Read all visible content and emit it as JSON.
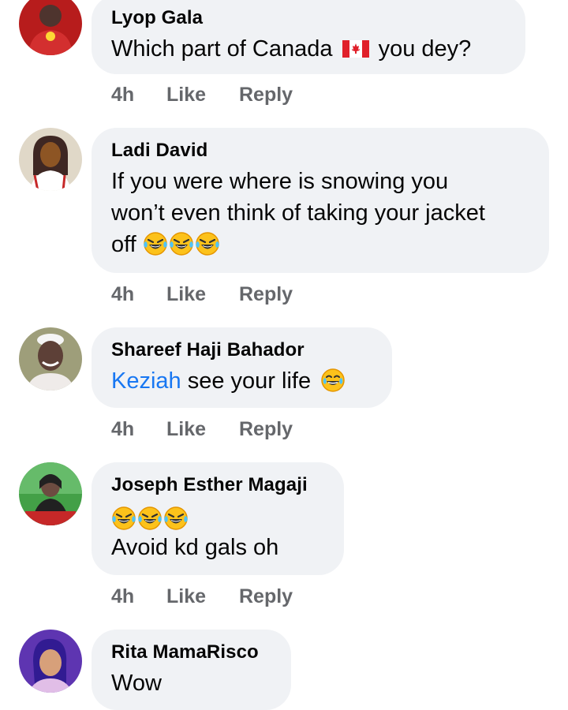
{
  "comments": [
    {
      "name": "Lyop Gala",
      "text_before": "Which  part of Canada",
      "text_after": "you dey?",
      "flag_icon": "canada-flag-icon",
      "time": "4h",
      "like": "Like",
      "reply": "Reply"
    },
    {
      "name": "Ladi David",
      "line1": "If you were where is snowing you",
      "line2": "won’t even think of taking your jacket",
      "line3": "off",
      "emoji_icon": "rolling-on-floor-laughing-emoji",
      "time": "4h",
      "like": "Like",
      "reply": "Reply"
    },
    {
      "name": "Shareef Haji Bahador",
      "mention": "Keziah",
      "text": "see your life",
      "emoji_icon": "face-with-tears-of-joy-emoji",
      "time": "4h",
      "like": "Like",
      "reply": "Reply"
    },
    {
      "name": "Joseph Esther Magaji",
      "emoji_icon": "rolling-on-floor-laughing-emoji",
      "text": "Avoid kd gals oh",
      "time": "4h",
      "like": "Like",
      "reply": "Reply"
    },
    {
      "name": "Rita MamaRisco",
      "text": "Wow"
    }
  ],
  "colors": {
    "bubble": "#f0f2f5",
    "name": "#050505",
    "action": "#65676b",
    "mention": "#1877f2"
  }
}
